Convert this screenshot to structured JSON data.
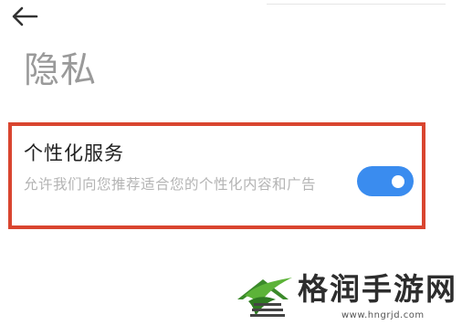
{
  "header": {
    "back_icon": "back-arrow-icon",
    "title": "隐私"
  },
  "setting": {
    "title": "个性化服务",
    "description": "允许我们向您推荐适合您的个性化内容和广告",
    "toggle_on": true,
    "toggle_color": "#3a8cef",
    "highlight_color": "#d9452f"
  },
  "watermark": {
    "text": "格润手游网",
    "url": "www.hngrjd.com",
    "logo_icon": "hngrjd-logo-icon"
  }
}
